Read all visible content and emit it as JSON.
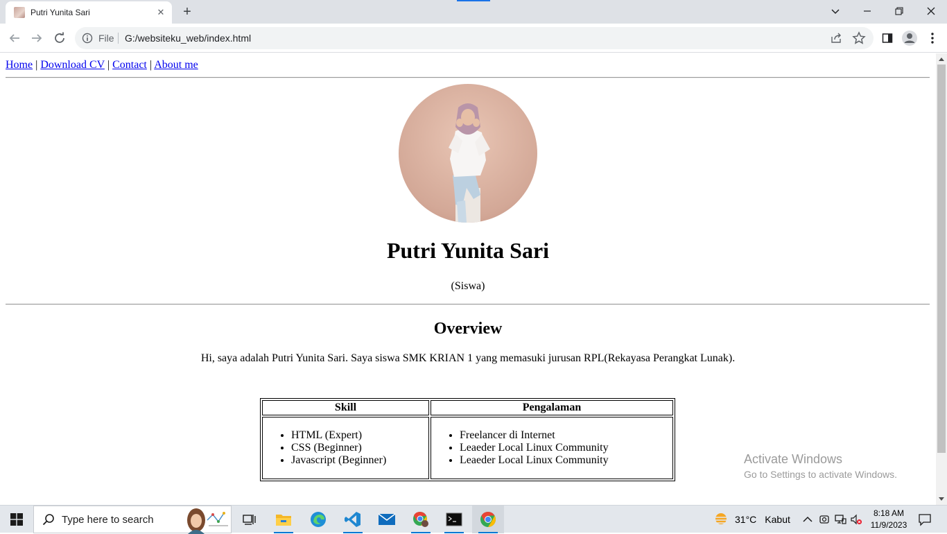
{
  "browser": {
    "tab_title": "Putri Yunita Sari",
    "address_scheme_label": "File",
    "address_url": "G:/websiteku_web/index.html"
  },
  "page": {
    "nav": {
      "home": "Home",
      "download_cv": "Download CV",
      "contact": "Contact",
      "about": "About me",
      "separator": "|"
    },
    "profile_name": "Putri Yunita Sari",
    "profile_role": "(Siswa)",
    "overview_title": "Overview",
    "overview_text": "Hi, saya adalah Putri Yunita Sari. Saya siswa SMK KRIAN 1 yang memasuki jurusan RPL(Rekayasa Perangkat Lunak).",
    "table": {
      "headers": [
        "Skill",
        "Pengalaman"
      ],
      "skills": [
        "HTML (Expert)",
        "CSS (Beginner)",
        "Javascript (Beginner)"
      ],
      "experience": [
        "Freelancer di Internet",
        "Leaeder Local Linux Community",
        "Leaeder Local Linux Community"
      ]
    }
  },
  "watermark": {
    "title": "Activate Windows",
    "subtitle": "Go to Settings to activate Windows."
  },
  "taskbar": {
    "search_placeholder": "Type here to search",
    "weather_temp": "31°C",
    "weather_desc": "Kabut",
    "time": "8:18 AM",
    "date": "11/9/2023"
  }
}
